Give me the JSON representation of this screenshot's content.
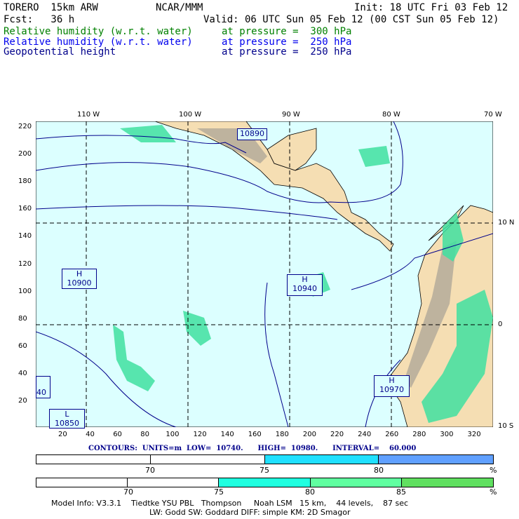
{
  "header": {
    "model": "TORERO  15km ARW",
    "org": "NCAR/MMM",
    "init": "Init: 18 UTC Fri 03 Feb 12",
    "fcst": "Fcst:   36 h",
    "valid": "Valid: 06 UTC Sun 05 Feb 12 (00 CST Sun 05 Feb 12)",
    "fields": [
      {
        "name": "Relative humidity (w.r.t. water)",
        "level": "at pressure =  300 hPa",
        "color": "#008000"
      },
      {
        "name": "Relative humidity (w.r.t. water)",
        "level": "at pressure =  250 hPa",
        "color": "#0000ee"
      },
      {
        "name": "Geopotential height",
        "level": "at pressure =  250 hPa",
        "color": "#00008b"
      }
    ]
  },
  "map": {
    "top_labels": [
      "110 W",
      "100 W",
      "90 W",
      "80 W",
      "70 W"
    ],
    "right_labels": [
      "10 N",
      "0",
      "10 S"
    ],
    "left_ticks": [
      "220",
      "200",
      "180",
      "160",
      "140",
      "120",
      "100",
      "80",
      "60",
      "40",
      "20"
    ],
    "bottom_ticks": [
      "20",
      "40",
      "60",
      "80",
      "100",
      "120",
      "140",
      "160",
      "180",
      "200",
      "220",
      "240",
      "260",
      "280",
      "300",
      "320"
    ],
    "highs_lows": [
      {
        "type": "H",
        "value": "10900"
      },
      {
        "type": "H",
        "value": "10940"
      },
      {
        "type": "H",
        "value": "10970"
      },
      {
        "type": "",
        "value": "10890"
      },
      {
        "type": "",
        "value": "40"
      },
      {
        "type": "L",
        "value": "10850"
      }
    ]
  },
  "contours": {
    "text": "CONTOURS:  UNITS=m  LOW=  10740.      HIGH=  10980.      INTERVAL=    60.000"
  },
  "colorbar1": {
    "labels": [
      "70",
      "75",
      "80",
      "%"
    ],
    "colors": [
      "#ffffff",
      "#ffffff",
      "#20e0ff",
      "#60a0ff"
    ]
  },
  "colorbar2": {
    "labels": [
      "70",
      "75",
      "80",
      "85",
      "%"
    ],
    "colors": [
      "#ffffff",
      "#ffffff",
      "#20ffe0",
      "#60ffa0",
      "#60e060"
    ]
  },
  "model_info": {
    "line1": "Model Info: V3.3.1    Tiedtke YSU PBL   Thompson     Noah LSM   15 km,    44 levels,    87 sec",
    "line2": "LW: Godd SW: Goddard DIFF: simple KM: 2D Smagor"
  }
}
